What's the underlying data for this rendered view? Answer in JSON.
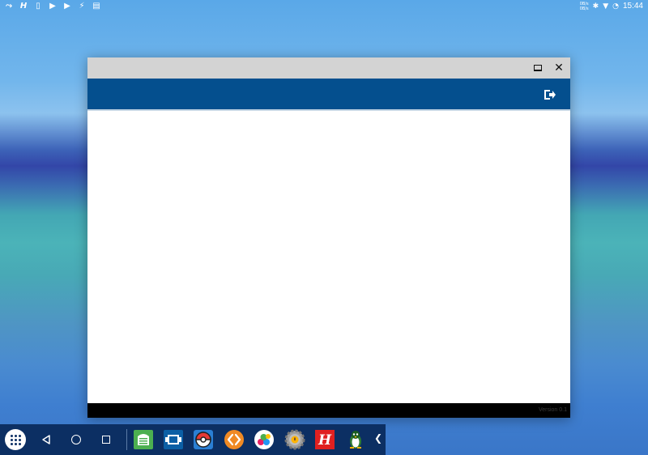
{
  "status_bar": {
    "left_icons": [
      "gesture-icon",
      "hacker-keyboard-icon",
      "sim-icon",
      "play-store-icon",
      "play-store-icon",
      "flash-icon",
      "clipboard-icon"
    ],
    "net_speed_up": "0B/s",
    "net_speed_down": "0B/s",
    "time": "15:44"
  },
  "window": {
    "app_bar_color": "#044f8e",
    "title_bar_color": "#d3d3d3",
    "footer_version": "Version 0.1"
  },
  "taskbar": {
    "apps": [
      "file-manager-icon",
      "app-switcher-icon",
      "pokeball-icon",
      "sharing-icon",
      "color-palette-icon",
      "settings-icon",
      "hacker-keyboard-icon",
      "penguin-icon"
    ]
  }
}
